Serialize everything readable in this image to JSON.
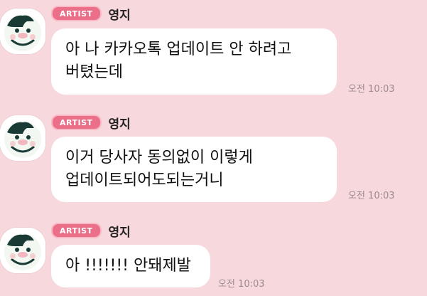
{
  "messages": [
    {
      "badge": "ARTIST",
      "name": "영지",
      "text": "아 나 카카오톡 업데이트 안 하려고\n버텼는데",
      "time": "오전 10:03"
    },
    {
      "badge": "ARTIST",
      "name": "영지",
      "text": "이거 당사자 동의없이 이렇게\n업데이트되어도되는거니",
      "time": "오전 10:03"
    },
    {
      "badge": "ARTIST",
      "name": "영지",
      "text": "아 !!!!!!! 안돼제발",
      "time": "오전 10:03"
    }
  ],
  "colors": {
    "background": "#f7d8dc",
    "bubble": "#ffffff",
    "badge": "#ec6f8a"
  },
  "icons": {
    "avatar": "avatar-icon"
  }
}
